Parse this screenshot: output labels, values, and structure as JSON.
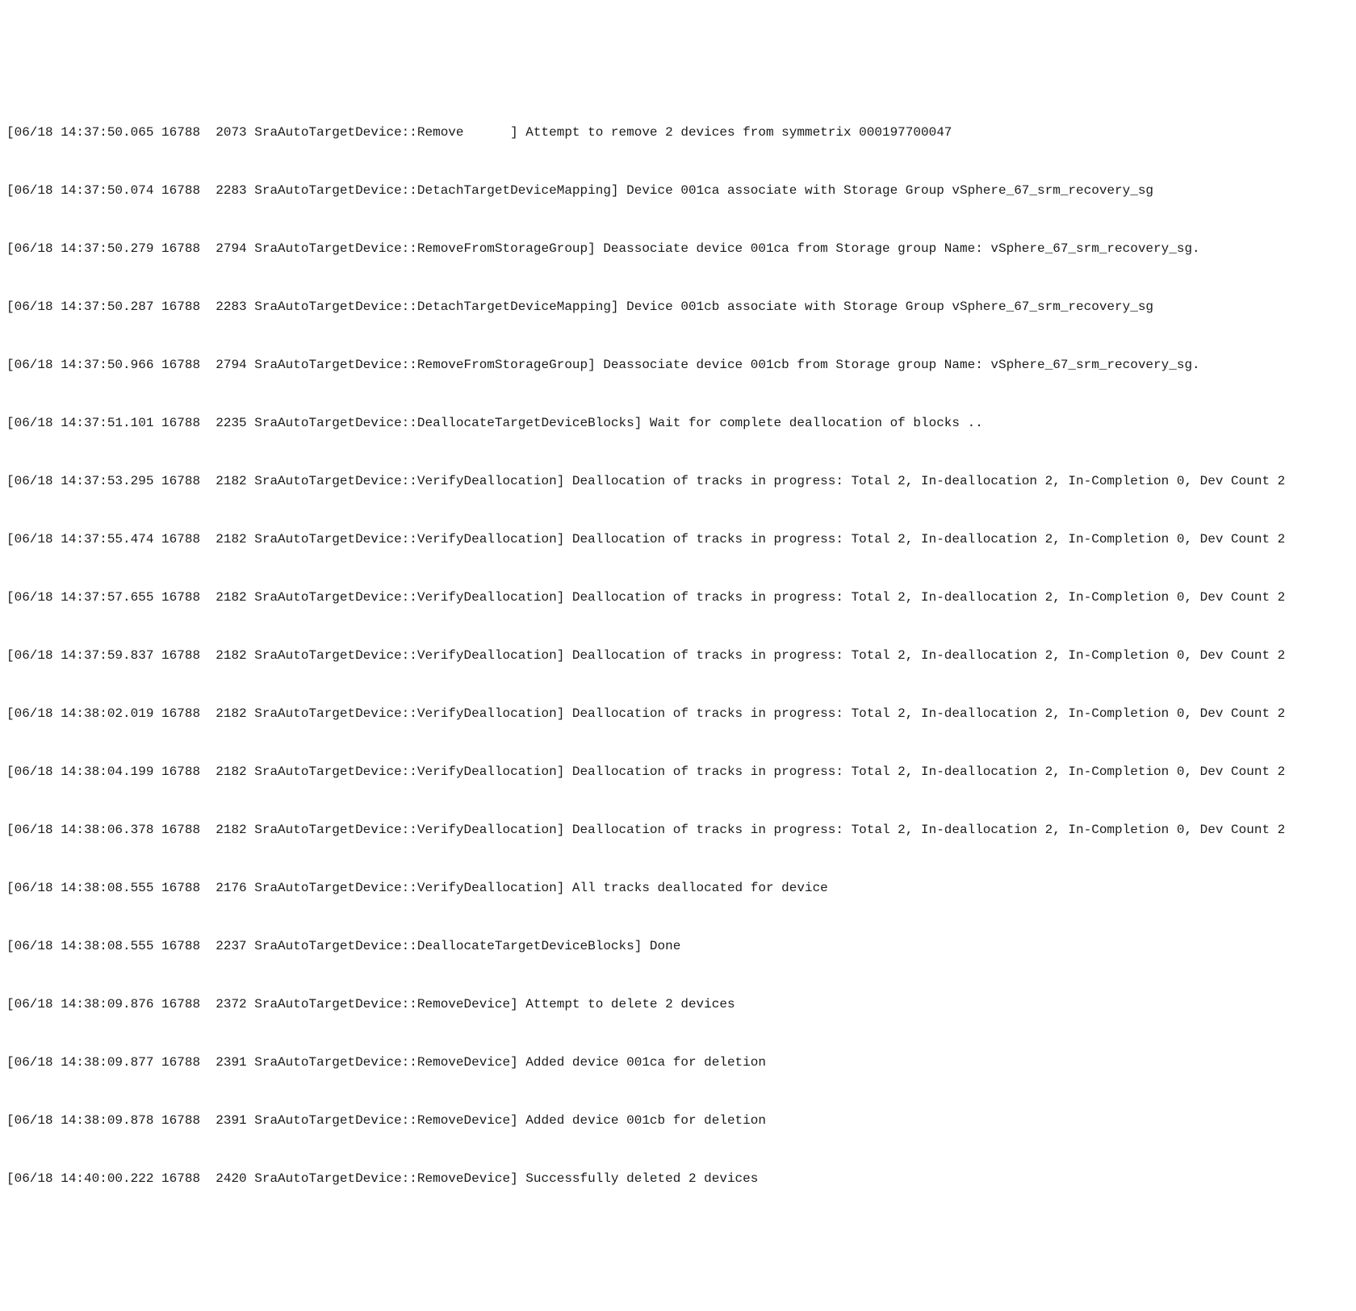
{
  "log_lines": [
    "[06/18 14:37:50.065 16788  2073 SraAutoTargetDevice::Remove      ] Attempt to remove 2 devices from symmetrix 000197700047",
    "[06/18 14:37:50.074 16788  2283 SraAutoTargetDevice::DetachTargetDeviceMapping] Device 001ca associate with Storage Group vSphere_67_srm_recovery_sg",
    "[06/18 14:37:50.279 16788  2794 SraAutoTargetDevice::RemoveFromStorageGroup] Deassociate device 001ca from Storage group Name: vSphere_67_srm_recovery_sg.",
    "[06/18 14:37:50.287 16788  2283 SraAutoTargetDevice::DetachTargetDeviceMapping] Device 001cb associate with Storage Group vSphere_67_srm_recovery_sg",
    "[06/18 14:37:50.966 16788  2794 SraAutoTargetDevice::RemoveFromStorageGroup] Deassociate device 001cb from Storage group Name: vSphere_67_srm_recovery_sg.",
    "[06/18 14:37:51.101 16788  2235 SraAutoTargetDevice::DeallocateTargetDeviceBlocks] Wait for complete deallocation of blocks ..",
    "[06/18 14:37:53.295 16788  2182 SraAutoTargetDevice::VerifyDeallocation] Deallocation of tracks in progress: Total 2, In-deallocation 2, In-Completion 0, Dev Count 2",
    "[06/18 14:37:55.474 16788  2182 SraAutoTargetDevice::VerifyDeallocation] Deallocation of tracks in progress: Total 2, In-deallocation 2, In-Completion 0, Dev Count 2",
    "[06/18 14:37:57.655 16788  2182 SraAutoTargetDevice::VerifyDeallocation] Deallocation of tracks in progress: Total 2, In-deallocation 2, In-Completion 0, Dev Count 2",
    "[06/18 14:37:59.837 16788  2182 SraAutoTargetDevice::VerifyDeallocation] Deallocation of tracks in progress: Total 2, In-deallocation 2, In-Completion 0, Dev Count 2",
    "[06/18 14:38:02.019 16788  2182 SraAutoTargetDevice::VerifyDeallocation] Deallocation of tracks in progress: Total 2, In-deallocation 2, In-Completion 0, Dev Count 2",
    "[06/18 14:38:04.199 16788  2182 SraAutoTargetDevice::VerifyDeallocation] Deallocation of tracks in progress: Total 2, In-deallocation 2, In-Completion 0, Dev Count 2",
    "[06/18 14:38:06.378 16788  2182 SraAutoTargetDevice::VerifyDeallocation] Deallocation of tracks in progress: Total 2, In-deallocation 2, In-Completion 0, Dev Count 2",
    "[06/18 14:38:08.555 16788  2176 SraAutoTargetDevice::VerifyDeallocation] All tracks deallocated for device",
    "[06/18 14:38:08.555 16788  2237 SraAutoTargetDevice::DeallocateTargetDeviceBlocks] Done",
    "[06/18 14:38:09.876 16788  2372 SraAutoTargetDevice::RemoveDevice] Attempt to delete 2 devices",
    "[06/18 14:38:09.877 16788  2391 SraAutoTargetDevice::RemoveDevice] Added device 001ca for deletion",
    "[06/18 14:38:09.878 16788  2391 SraAutoTargetDevice::RemoveDevice] Added device 001cb for deletion",
    "[06/18 14:40:00.222 16788  2420 SraAutoTargetDevice::RemoveDevice] Successfully deleted 2 devices"
  ]
}
